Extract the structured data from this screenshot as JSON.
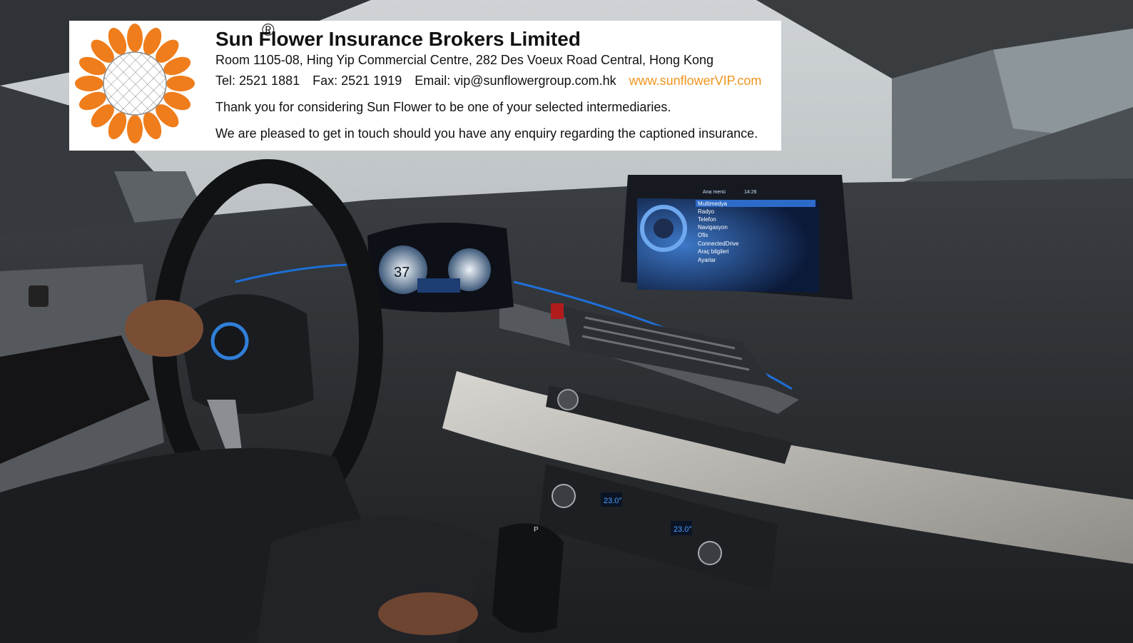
{
  "company": {
    "name": "Sun Flower Insurance Brokers Limited",
    "registered_mark": "®",
    "address": "Room 1105-08, Hing Yip Commercial Centre, 282 Des Voeux Road Central, Hong Kong",
    "tel": "Tel: 2521 1881",
    "fax": "Fax: 2521 1919",
    "email": "Email: vip@sunflowergroup.com.hk",
    "website": "www.sunflowerVIP.com",
    "message_1": "Thank you for considering Sun Flower to be one of your selected intermediaries.",
    "message_2": "We are pleased to get in touch should you have any enquiry regarding the captioned insurance."
  },
  "photo": {
    "cluster_speed": "37",
    "screen_header": "Ana menü",
    "screen_time": "14:26",
    "screen_menu": [
      "Multimedya",
      "Radyo",
      "Telefon",
      "Navigasyon",
      "Ofis",
      "ConnectedDrive",
      "Araç bilgileri",
      "Ayarlar"
    ],
    "temp_left": "23.0°",
    "temp_right": "23.0°",
    "gear_label": "P"
  },
  "colors": {
    "logo_orange": "#ef7d1c",
    "website": "#f0951e",
    "accent_blue": "#1e6fd8"
  }
}
